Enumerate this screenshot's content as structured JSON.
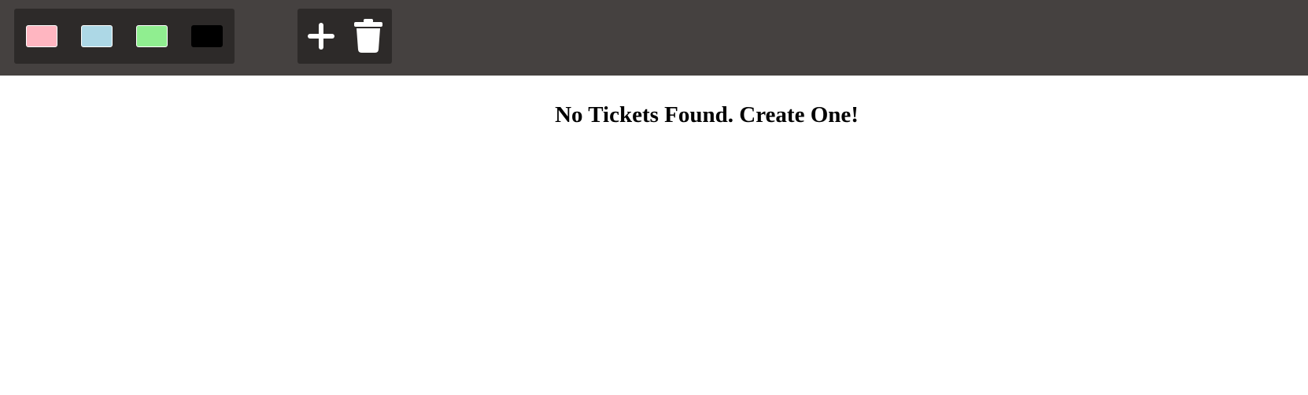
{
  "toolbar": {
    "filters": [
      {
        "name": "pink",
        "color": "#ffb6c1"
      },
      {
        "name": "lightblue",
        "color": "#add8e6"
      },
      {
        "name": "lightgreen",
        "color": "#90ee90"
      },
      {
        "name": "black",
        "color": "#000000"
      }
    ],
    "actions": [
      {
        "icon": "plus-icon"
      },
      {
        "icon": "trash-icon"
      }
    ]
  },
  "main": {
    "empty_message": "No Tickets Found. Create One!"
  }
}
